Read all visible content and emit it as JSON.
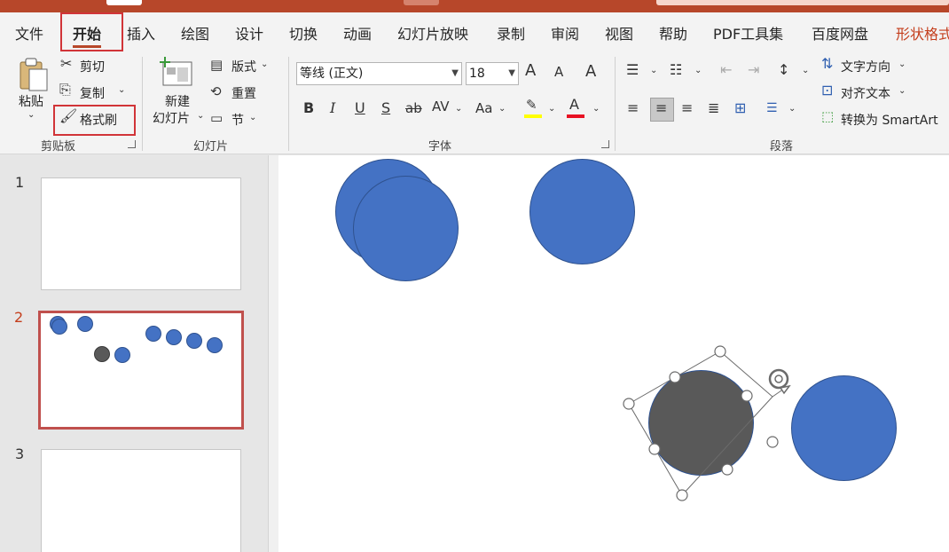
{
  "titlebar": {
    "accent": "#b7472a"
  },
  "tabs": [
    {
      "label": "文件"
    },
    {
      "label": "开始"
    },
    {
      "label": "插入"
    },
    {
      "label": "绘图"
    },
    {
      "label": "设计"
    },
    {
      "label": "切换"
    },
    {
      "label": "动画"
    },
    {
      "label": "幻灯片放映"
    },
    {
      "label": "录制"
    },
    {
      "label": "审阅"
    },
    {
      "label": "视图"
    },
    {
      "label": "帮助"
    },
    {
      "label": "PDF工具集"
    },
    {
      "label": "百度网盘"
    },
    {
      "label": "形状格式"
    }
  ],
  "clipboard": {
    "paste": "粘贴",
    "cut": "剪切",
    "copy": "复制",
    "format_painter": "格式刷",
    "group": "剪贴板"
  },
  "slides_group": {
    "new_slide_line1": "新建",
    "new_slide_line2": "幻灯片",
    "layout": "版式",
    "reset": "重置",
    "section": "节",
    "group": "幻灯片"
  },
  "font": {
    "name": "等线 (正文)",
    "size": "18",
    "group": "字体",
    "increase": "A",
    "decrease": "A",
    "bold": "B",
    "italic": "I",
    "underline": "U",
    "shadow": "S",
    "strike": "ab",
    "spacing": "AV",
    "case": "Aa",
    "highlight_color": "#ffff00",
    "font_color": "#e81123"
  },
  "paragraph": {
    "text_direction": "文字方向",
    "align_text": "对齐文本",
    "smartart": "转换为 SmartArt",
    "group": "段落"
  },
  "thumbnails": [
    {
      "number": "1"
    },
    {
      "number": "2"
    },
    {
      "number": "3"
    }
  ],
  "colors": {
    "shape_fill": "#4472c4",
    "shape_border": "#2f528f",
    "dark_fill": "#595959",
    "active_accent": "#c43e1c"
  }
}
